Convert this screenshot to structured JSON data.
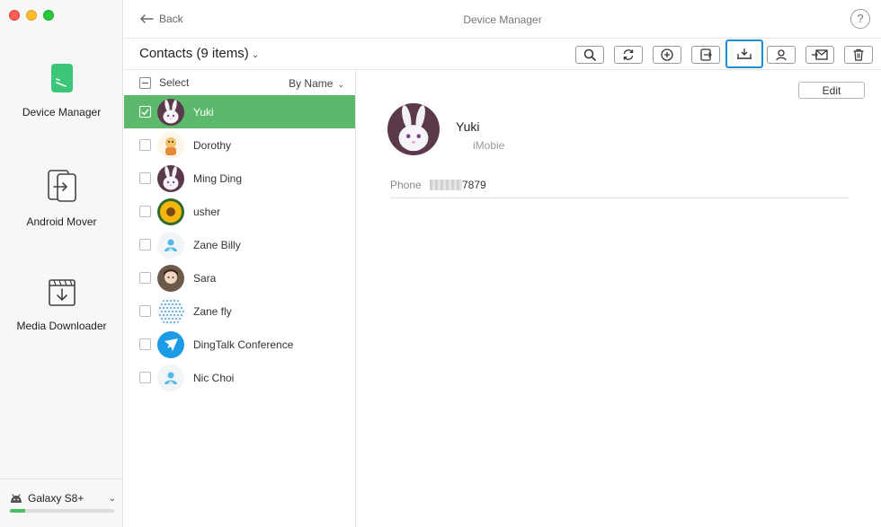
{
  "window": {
    "title": "Device Manager",
    "back_label": "Back",
    "help_label": "?"
  },
  "sidebar": {
    "items": [
      {
        "label": "Device Manager",
        "icon": "phone-icon"
      },
      {
        "label": "Android Mover",
        "icon": "transfer-icon"
      },
      {
        "label": "Media Downloader",
        "icon": "download-icon"
      }
    ],
    "device": {
      "name": "Galaxy S8+",
      "icon": "android-icon",
      "storage_used_fraction": 0.15
    }
  },
  "header": {
    "title": "Contacts (9 items)",
    "toolbar": [
      "search-icon",
      "refresh-icon",
      "add-icon",
      "export-icon",
      "import-icon",
      "contact-icon",
      "send-icon",
      "trash-icon"
    ],
    "active_tool": "import-icon"
  },
  "list": {
    "select_label": "Select",
    "sort_label": "By Name",
    "contacts": [
      {
        "name": "Yuki",
        "avatar": "bunny",
        "selected": true
      },
      {
        "name": "Dorothy",
        "avatar": "cartoon",
        "selected": false
      },
      {
        "name": "Ming Ding",
        "avatar": "bunny",
        "selected": false
      },
      {
        "name": "usher",
        "avatar": "sunflower",
        "selected": false
      },
      {
        "name": "Zane Billy",
        "avatar": "default",
        "selected": false
      },
      {
        "name": "Sara",
        "avatar": "girl",
        "selected": false
      },
      {
        "name": "Zane fly",
        "avatar": "dots",
        "selected": false
      },
      {
        "name": "DingTalk Conference",
        "avatar": "dingtalk",
        "selected": false
      },
      {
        "name": "Nic Choi",
        "avatar": "default",
        "selected": false
      }
    ]
  },
  "detail": {
    "edit_label": "Edit",
    "name": "Yuki",
    "company": "iMobie",
    "phone_label": "Phone",
    "phone_value": "7879"
  },
  "colors": {
    "selected_row": "#5cb86a",
    "active_tool_border": "#1c8fd6",
    "icon_green": "#3cc67a"
  }
}
